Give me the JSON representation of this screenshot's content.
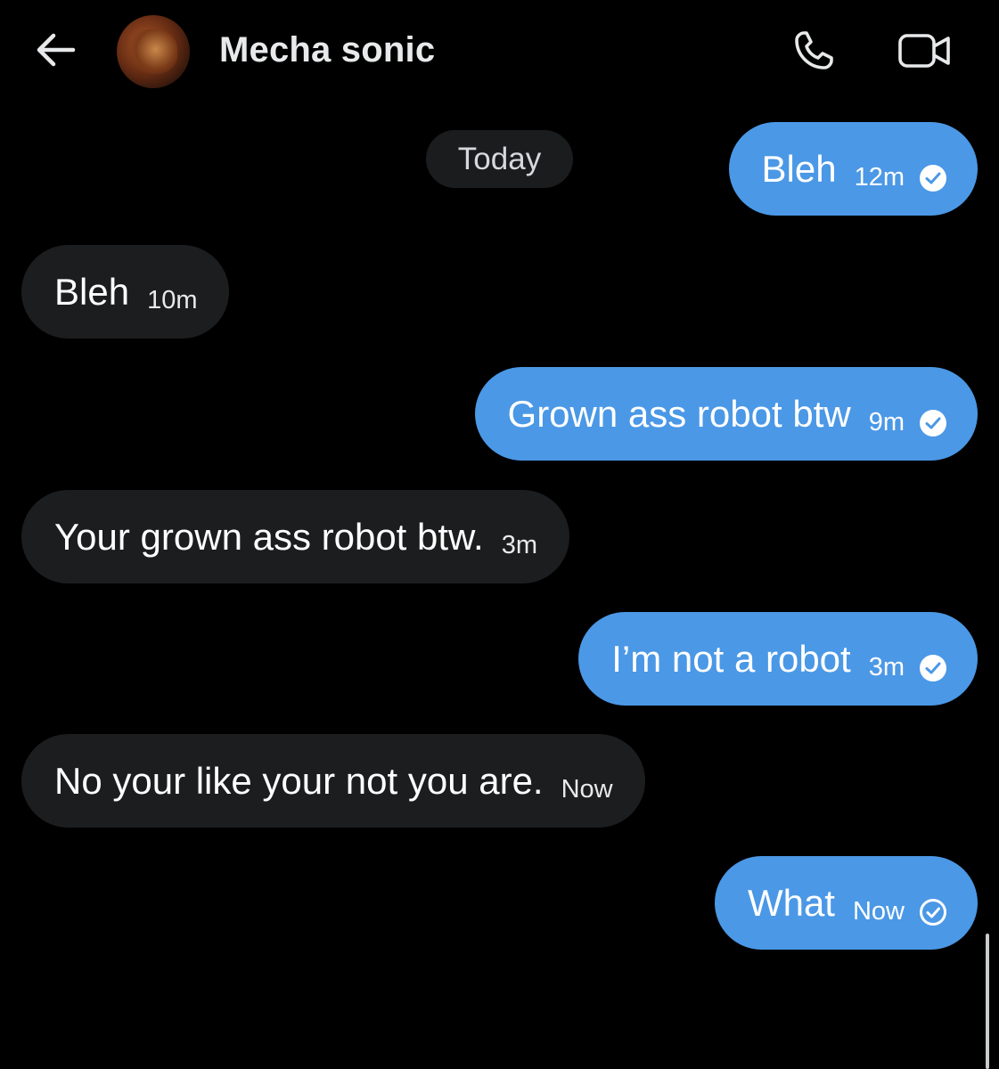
{
  "header": {
    "contact_name": "Mecha sonic"
  },
  "date_divider": "Today",
  "messages": [
    {
      "direction": "sent",
      "text": "Bleh",
      "time": "12m",
      "status": "read"
    },
    {
      "direction": "received",
      "text": "Bleh",
      "time": "10m"
    },
    {
      "direction": "sent",
      "text": "Grown ass robot btw",
      "time": "9m",
      "status": "read"
    },
    {
      "direction": "received",
      "text": "Your grown ass robot btw.",
      "time": "3m"
    },
    {
      "direction": "sent",
      "text": "I’m not a robot",
      "time": "3m",
      "status": "read"
    },
    {
      "direction": "received",
      "text": "No your like your not you are.",
      "time": "Now"
    },
    {
      "direction": "sent",
      "text": "What",
      "time": "Now",
      "status": "sent"
    }
  ],
  "colors": {
    "background": "#000000",
    "sent_bubble": "#4b98e6",
    "received_bubble": "#1c1d1f",
    "date_pill": "#1b1c1e"
  },
  "icons": {
    "back": "arrow-left-icon",
    "call": "phone-icon",
    "video": "video-camera-icon",
    "read": "check-circle-filled-icon",
    "sent": "check-circle-outline-icon"
  }
}
